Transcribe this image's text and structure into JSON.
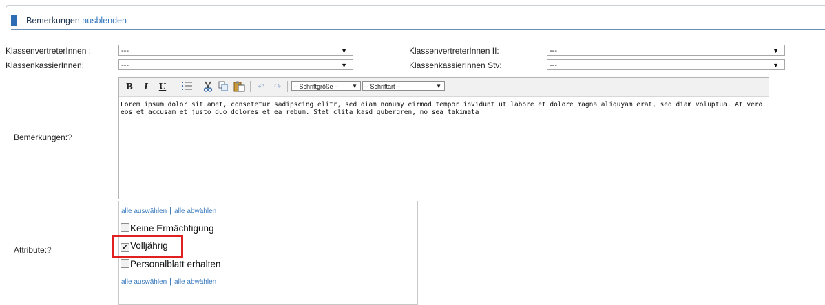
{
  "section": {
    "title": "Bemerkungen",
    "toggle": "ausblenden",
    "accent": "#2e6db4"
  },
  "form": {
    "vertreter_label": "KlassenvertreterInnen :",
    "vertreter_value": "---",
    "kassier_label": "KlassenkassierInnen:",
    "kassier_value": "---",
    "vertreter2_label": "KlassenvertreterInnen II:",
    "vertreter2_value": "---",
    "kassier_stv_label": "KlassenkassierInnen Stv:",
    "kassier_stv_value": "---",
    "bemerkungen_label": "Bemerkungen:",
    "attribute_label": "Attribute:",
    "help_mark": "?"
  },
  "editor": {
    "toolbar": {
      "bold": "B",
      "italic": "I",
      "underline": "U",
      "list_icon": "list-icon",
      "cut_icon": "cut-icon",
      "copy_icon": "copy-icon",
      "paste_icon": "paste-icon",
      "undo_icon": "undo-icon",
      "redo_icon": "redo-icon",
      "font_size": "-- Schriftgröße --",
      "font_family": "-- Schriftart --"
    },
    "content": "Lorem ipsum dolor sit amet, consetetur sadipscing elitr, sed diam nonumy eirmod tempor invidunt ut labore et dolore magna aliquyam erat, sed diam voluptua. At vero eos et accusam et justo duo dolores et ea rebum. Stet clita kasd gubergren, no sea takimata"
  },
  "attributes": {
    "select_all": "alle auswählen",
    "deselect_all": "alle abwählen",
    "options": [
      {
        "label": "Keine Ermächtigung",
        "checked": false
      },
      {
        "label": "Volljährig",
        "checked": true
      },
      {
        "label": "Personalblatt erhalten",
        "checked": false
      }
    ],
    "highlight_color": "#e02020"
  }
}
